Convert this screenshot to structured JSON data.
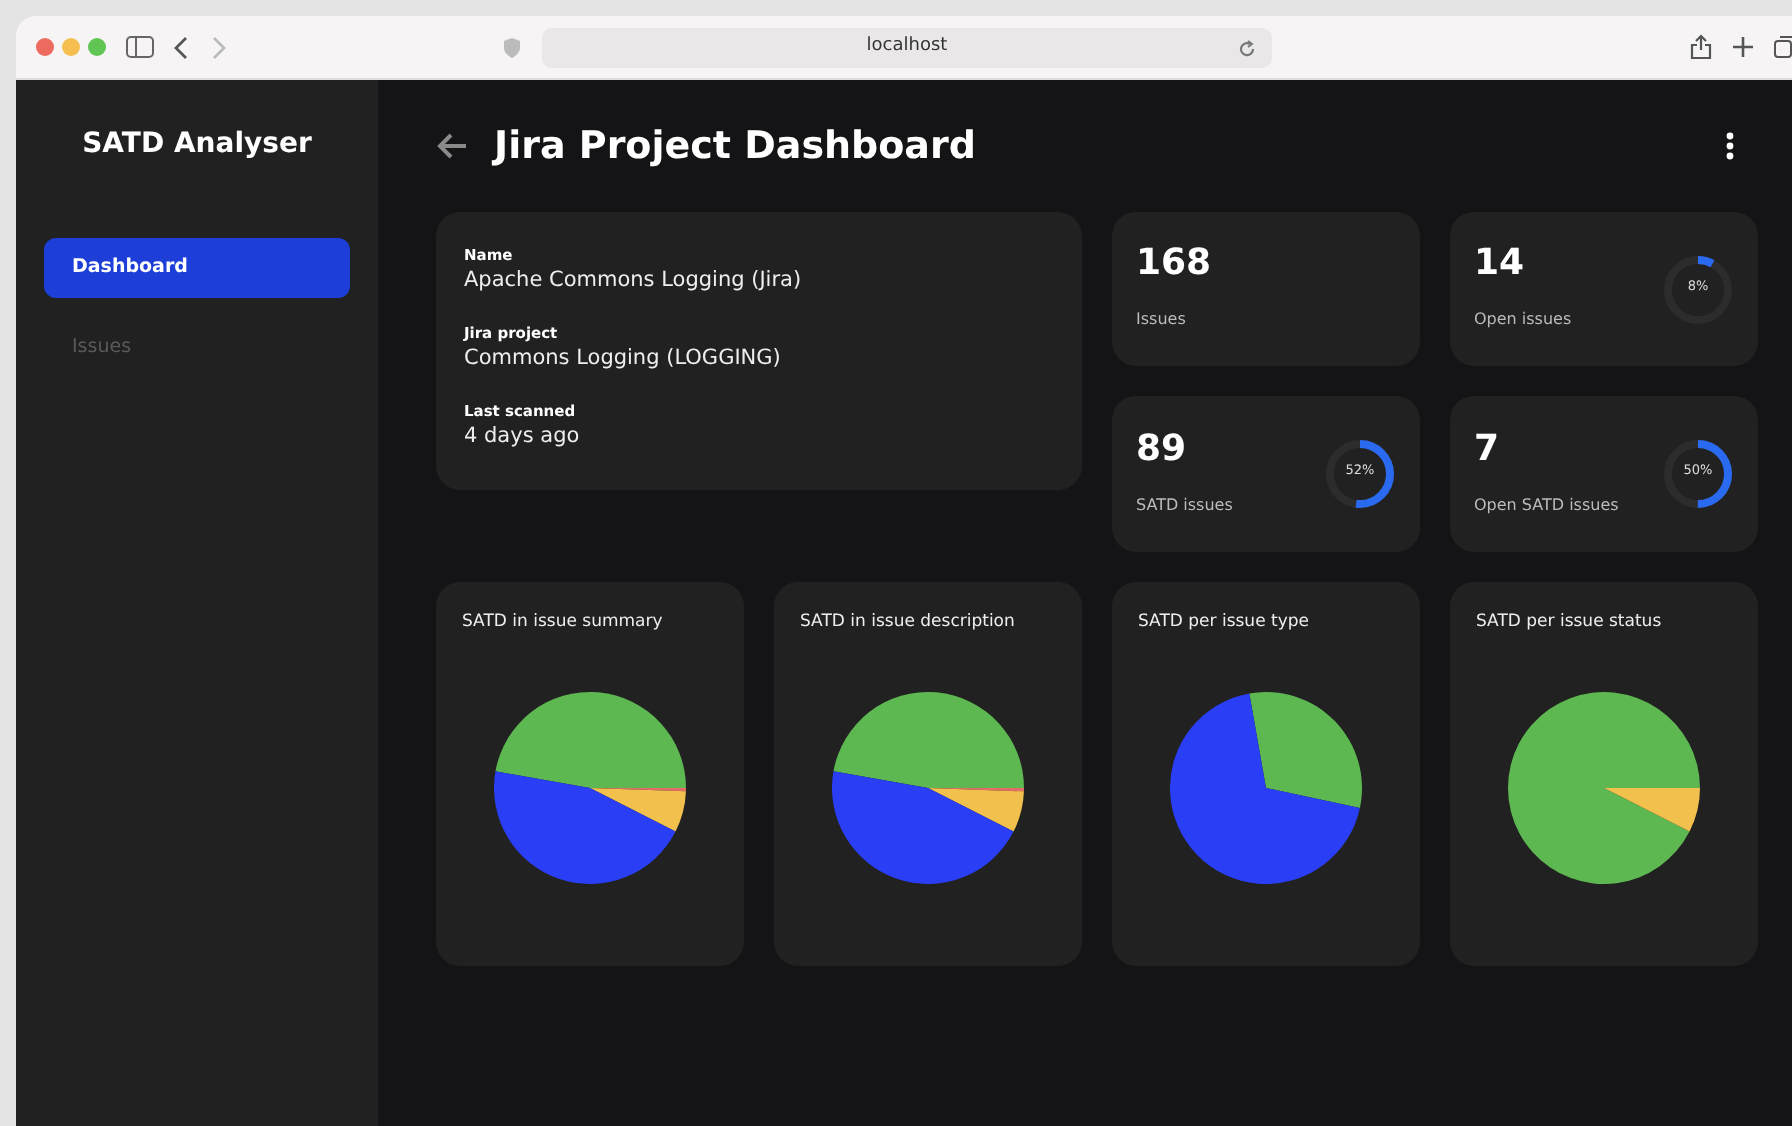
{
  "browser": {
    "url": "localhost"
  },
  "sidebar": {
    "title": "SATD Analyser",
    "items": [
      {
        "label": "Dashboard",
        "selected": true
      },
      {
        "label": "Issues",
        "selected": false
      }
    ]
  },
  "header": {
    "title": "Jira Project Dashboard"
  },
  "project": [
    {
      "label": "Name",
      "value": "Apache Commons Logging (Jira)"
    },
    {
      "label": "Jira project",
      "value": "Commons Logging (LOGGING)"
    },
    {
      "label": "Last scanned",
      "value": "4 days ago"
    }
  ],
  "stats": [
    {
      "value": "168",
      "label": "Issues"
    },
    {
      "value": "14",
      "label": "Open issues",
      "level": 0.08,
      "reading": "8%"
    },
    {
      "value": "89",
      "label": "SATD issues",
      "level": 0.52,
      "reading": "52%"
    },
    {
      "value": "7",
      "label": "Open SATD issues",
      "level": 0.5,
      "reading": "50%"
    }
  ],
  "charts": [
    {
      "title": "SATD in issue summary"
    },
    {
      "title": "SATD in issue description"
    },
    {
      "title": "SATD per issue type"
    },
    {
      "title": "SATD per issue status"
    }
  ]
}
